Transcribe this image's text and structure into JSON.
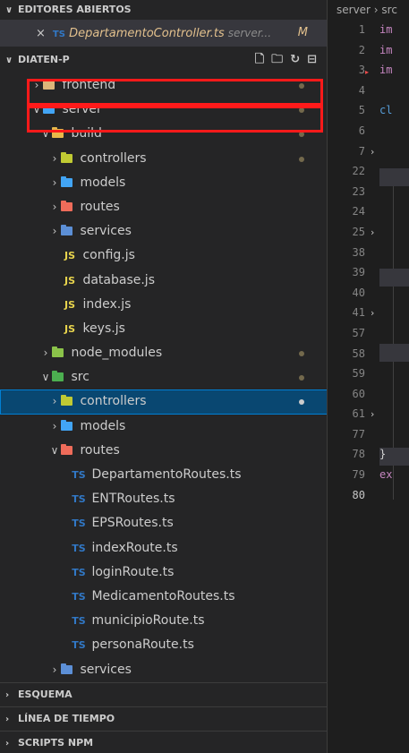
{
  "open_editors": {
    "header": "EDITORES ABIERTOS",
    "items": [
      {
        "close": "×",
        "icon": "TS",
        "name": "DepartamentoController.ts",
        "desc": "server...",
        "status": "M"
      }
    ]
  },
  "explorer": {
    "header": "DIATEN-P",
    "tools": [
      "new-file",
      "new-folder",
      "refresh",
      "collapse-all"
    ]
  },
  "tree": {
    "frontend": "frontend",
    "server": "server",
    "build": "build",
    "build_controllers": "controllers",
    "build_models": "models",
    "build_routes": "routes",
    "build_services": "services",
    "config": "config.js",
    "database": "database.js",
    "index": "index.js",
    "keys": "keys.js",
    "node_modules": "node_modules",
    "src": "src",
    "src_controllers": "controllers",
    "src_models": "models",
    "src_routes": "routes",
    "r1": "DepartamentoRoutes.ts",
    "r2": "ENTRoutes.ts",
    "r3": "EPSRoutes.ts",
    "r4": "indexRoute.ts",
    "r5": "loginRoute.ts",
    "r6": "MedicamentoRoutes.ts",
    "r7": "municipioRoute.ts",
    "r8": "personaRoute.ts",
    "src_services": "services"
  },
  "icons": {
    "ts": "TS",
    "js": "JS"
  },
  "sections": {
    "esquema": "ESQUEMA",
    "timeline": "LÍNEA DE TIEMPO",
    "npm": "SCRIPTS NPM"
  },
  "editor": {
    "breadcrumb": "server › src",
    "lines": [
      {
        "n": "1",
        "code": "im"
      },
      {
        "n": "2",
        "code": "im"
      },
      {
        "n": "3",
        "code": "im"
      },
      {
        "n": "4",
        "code": ""
      },
      {
        "n": "5",
        "code": "cl"
      },
      {
        "n": "6",
        "code": ""
      },
      {
        "n": "7",
        "code": ""
      },
      {
        "n": "22",
        "code": ""
      },
      {
        "n": "23",
        "code": ""
      },
      {
        "n": "24",
        "code": ""
      },
      {
        "n": "25",
        "code": ""
      },
      {
        "n": "38",
        "code": ""
      },
      {
        "n": "39",
        "code": ""
      },
      {
        "n": "40",
        "code": ""
      },
      {
        "n": "41",
        "code": ""
      },
      {
        "n": "57",
        "code": ""
      },
      {
        "n": "58",
        "code": ""
      },
      {
        "n": "59",
        "code": ""
      },
      {
        "n": "60",
        "code": ""
      },
      {
        "n": "61",
        "code": ""
      },
      {
        "n": "77",
        "code": ""
      },
      {
        "n": "78",
        "code": "}"
      },
      {
        "n": "79",
        "code": "ex"
      },
      {
        "n": "80",
        "code": ""
      }
    ]
  },
  "colors": {
    "highlight": "#ff1a1a",
    "selection": "#094771"
  }
}
